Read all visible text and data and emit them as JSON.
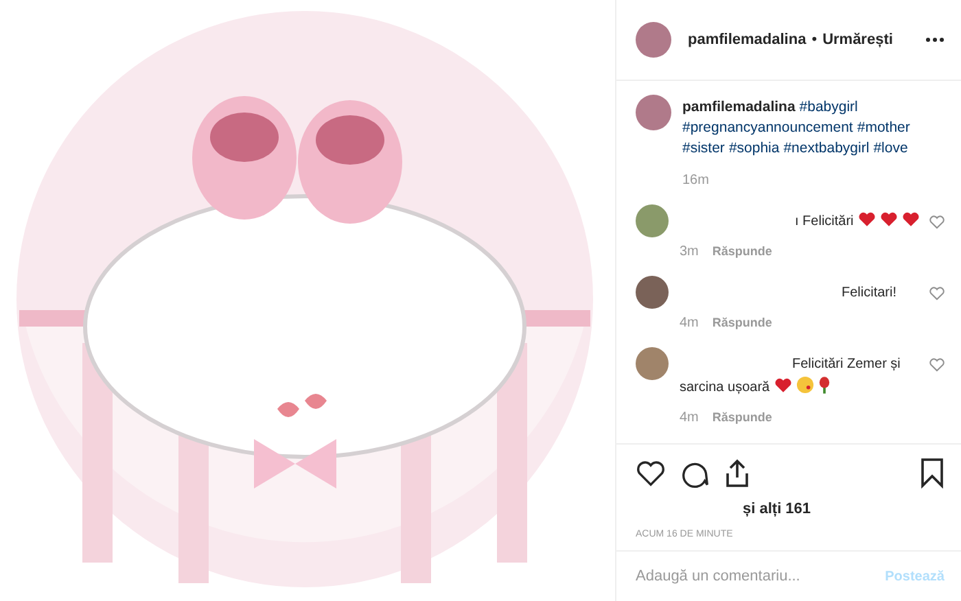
{
  "header": {
    "username": "pamfilemadalina",
    "separator": "•",
    "follow": "Urmărești"
  },
  "caption": {
    "username": "pamfilemadalina",
    "hashtags": [
      "#babygirl",
      "#pregnancyannouncement",
      "#mother",
      "#sister",
      "#sophia",
      "#nextbabygirl",
      "#love"
    ],
    "time": "16m"
  },
  "comments": [
    {
      "text": "ı Felicitări",
      "emoji": [
        {
          "kind": "heart"
        },
        {
          "kind": "heart"
        },
        {
          "kind": "heart"
        }
      ],
      "time": "3m",
      "reply": "Răspunde"
    },
    {
      "text": "Felicitari!",
      "time": "4m",
      "reply": "Răspunde"
    },
    {
      "text": "Felicitări Zemer și sarcina ușoară",
      "emoji": [
        {
          "kind": "heart"
        },
        {
          "kind": "face"
        },
        {
          "kind": "rose"
        }
      ],
      "time": "4m",
      "reply": "Răspunde"
    }
  ],
  "likes": "și alți 161",
  "timestamp": "ACUM 16 DE MINUTE",
  "comment_box": {
    "placeholder": "Adaugă un comentariu...",
    "post": "Postează",
    "disabled": true
  }
}
